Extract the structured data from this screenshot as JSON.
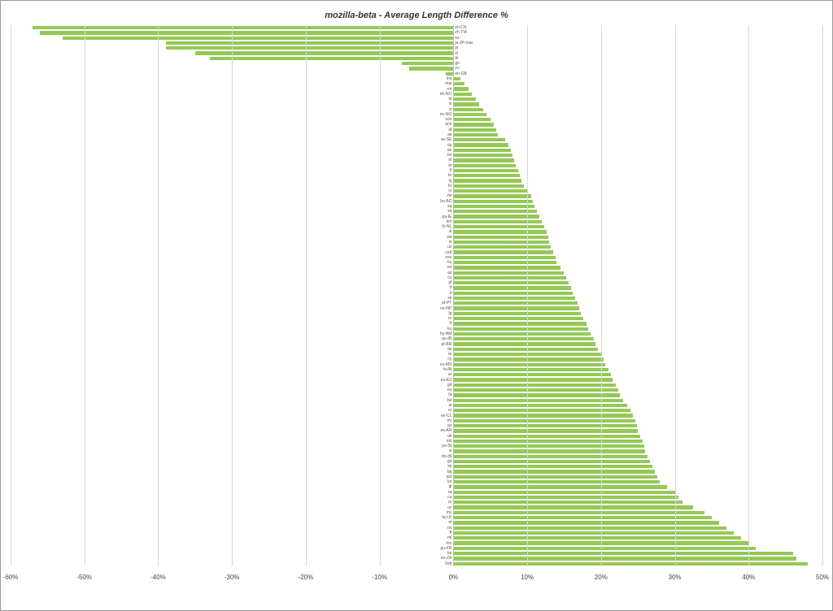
{
  "chart_data": {
    "type": "bar",
    "orientation": "horizontal",
    "title": "mozilla-beta - Average Length Difference %",
    "xlabel": "",
    "ylabel": "",
    "xlim": [
      -60,
      50
    ],
    "xticks": [
      -60,
      -50,
      -40,
      -30,
      -20,
      -10,
      0,
      10,
      20,
      30,
      40,
      50
    ],
    "xtick_format": "percent",
    "bar_color": "#94c954",
    "categories": [
      "zh-CN",
      "zh-TW",
      "ko",
      "ja-JP-mac",
      "ja",
      "lo",
      "th",
      "gn",
      "zu",
      "en-GB",
      "ms",
      "mai",
      "rm",
      "nb-NO",
      "id",
      "lv",
      "tr",
      "nn-NO",
      "son",
      "ach",
      "af",
      "ak",
      "sv-SE",
      "da",
      "an",
      "bs",
      "nl",
      "et",
      "fi",
      "br",
      "lij",
      "hr",
      "sr",
      "he",
      "bn-BD",
      "sq",
      "xh",
      "ga-IE",
      "km",
      "fy-NL",
      "sl",
      "sw",
      "is",
      "uz",
      "csb",
      "nso",
      "hu",
      "eo",
      "az",
      "cs",
      "pl",
      "lt",
      "it",
      "sk",
      "pt-PT",
      "ne-NP",
      "lg",
      "ro",
      "fr",
      "ku",
      "hy-AM",
      "gu-IN",
      "pt-BR",
      "de",
      "te",
      "cy",
      "es-MX",
      "hi-IN",
      "ar",
      "es-ES",
      "gd",
      "eu",
      "fa",
      "be",
      "si",
      "or",
      "es-CL",
      "mr",
      "as",
      "es-AR",
      "uk",
      "mk",
      "pa-IN",
      "vi",
      "bn-IN",
      "ga",
      "kk",
      "bg",
      "ast",
      "kn",
      "gl",
      "ta",
      "ca",
      "ru",
      "oc",
      "my",
      "ta-LK",
      "el",
      "rw",
      "ff",
      "ml",
      "mn",
      "gu-FR",
      "ka",
      "en-ZA",
      "hsb"
    ],
    "values": [
      -57,
      -56,
      -53,
      -39,
      -39,
      -35,
      -33,
      -7,
      -6,
      -1,
      1,
      1.5,
      2,
      2.5,
      3,
      3.5,
      4,
      4.5,
      5,
      5.5,
      5.8,
      6,
      7,
      7.5,
      7.8,
      8,
      8.2,
      8.5,
      8.8,
      9,
      9.2,
      9.5,
      10,
      10.5,
      10.8,
      11,
      11.3,
      11.6,
      12,
      12.3,
      12.6,
      12.9,
      13,
      13.2,
      13.5,
      13.8,
      14,
      14.5,
      15,
      15.3,
      15.6,
      15.9,
      16.2,
      16.5,
      16.8,
      17,
      17.3,
      17.6,
      18,
      18.3,
      18.6,
      19,
      19.3,
      19.6,
      20,
      20.3,
      20.6,
      21,
      21.3,
      21.6,
      22,
      22.3,
      22.6,
      23,
      23.5,
      24,
      24.3,
      24.6,
      24.9,
      25,
      25.3,
      25.6,
      25.9,
      26,
      26.3,
      26.6,
      27,
      27.3,
      27.6,
      28,
      29,
      30,
      30.5,
      31,
      32.5,
      34,
      35,
      36,
      37,
      38,
      39,
      40,
      41,
      46,
      46.5,
      48
    ]
  }
}
